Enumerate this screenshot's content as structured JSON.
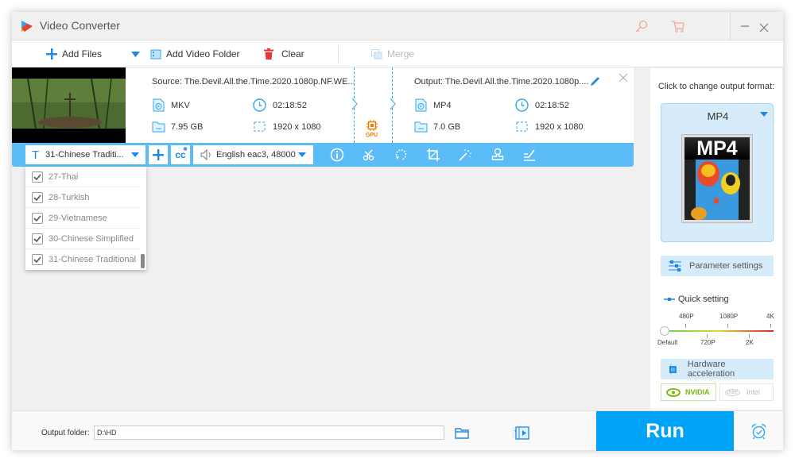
{
  "app": {
    "title": "Video Converter",
    "accent_color": "#00a2f8",
    "subbar_color": "#5bbcf7"
  },
  "titlebar": {
    "icons": [
      "key-icon",
      "cart-icon",
      "minimize-icon",
      "close-icon"
    ]
  },
  "toolbar": {
    "add_files_label": "Add Files",
    "add_video_folder_label": "Add Video Folder",
    "clear_label": "Clear",
    "merge_label": "Merge"
  },
  "file": {
    "source_label": "Source: The.Devil.All.the.Time.2020.1080p.NF.WE...",
    "source_format": "MKV",
    "source_duration": "02:18:52",
    "source_size": "7.95 GB",
    "source_resolution": "1920 x 1080",
    "gpu_label": "GPU",
    "output_label": "Output: The.Devil.All.the.Time.2020.1080p....",
    "output_format": "MP4",
    "output_duration": "02:18:52",
    "output_size": "7.0 GB",
    "output_resolution": "1920 x 1080"
  },
  "subbar": {
    "subtitle_selected": "31-Chinese Traditi...",
    "audio_selected": "English eac3, 48000",
    "tools": [
      "info-icon",
      "scissors-icon",
      "rotate-icon",
      "crop-icon",
      "effects-wand-icon",
      "watermark-stamp-icon",
      "subtitle-edit-icon"
    ]
  },
  "subtitle_dropdown": {
    "items": [
      {
        "label": "27-Thai",
        "checked": true
      },
      {
        "label": "28-Turkish",
        "checked": true
      },
      {
        "label": "29-Vietnamese",
        "checked": true
      },
      {
        "label": "30-Chinese Simplified",
        "checked": true
      },
      {
        "label": "31-Chinese Traditional",
        "checked": true
      }
    ]
  },
  "right_panel": {
    "change_format_label": "Click to change output format:",
    "format_name": "MP4",
    "format_badge": "MP4",
    "parameter_settings_label": "Parameter settings",
    "quick_setting_label": "Quick setting",
    "quality_top_ticks": [
      "480P",
      "1080P",
      "4K"
    ],
    "quality_bottom_ticks": [
      "Default",
      "720P",
      "2K"
    ],
    "quality_selected": "Default",
    "hardware_acceleration_label": "Hardware acceleration",
    "nvidia_label": "NVIDIA",
    "intel_label": "Intel",
    "intel_badge": "intel",
    "nvidia_enabled": true,
    "intel_enabled": false
  },
  "bottom": {
    "output_folder_label": "Output folder:",
    "output_folder_value": "D:\\HD",
    "run_label": "Run"
  }
}
